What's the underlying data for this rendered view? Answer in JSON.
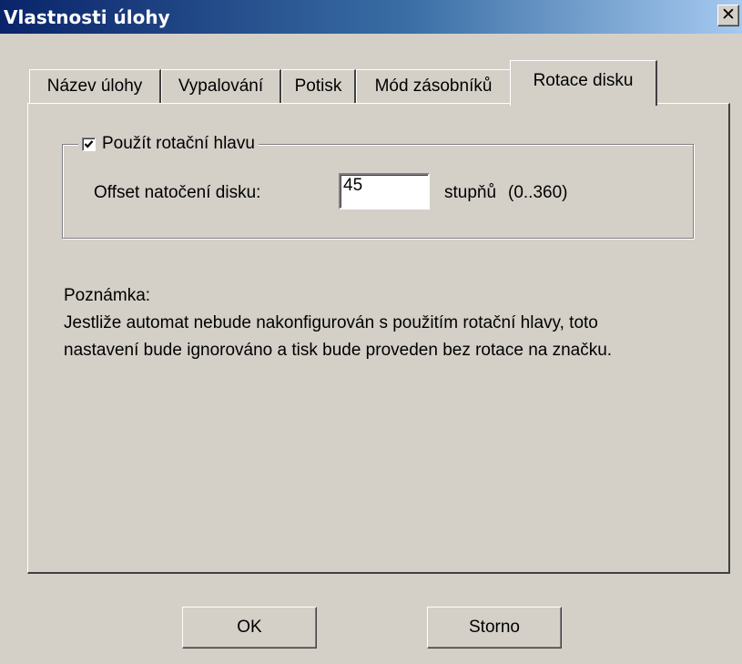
{
  "window": {
    "title": "Vlastnosti úlohy",
    "close_glyph": "✕"
  },
  "tabs": [
    {
      "label": "Název úlohy",
      "selected": false
    },
    {
      "label": "Vypalování",
      "selected": false
    },
    {
      "label": "Potisk",
      "selected": false
    },
    {
      "label": "Mód zásobníků",
      "selected": false
    },
    {
      "label": "Rotace disku",
      "selected": true
    }
  ],
  "rotation_group": {
    "checkbox_label": "Použít rotační hlavu",
    "checked": true,
    "offset_label": "Offset natočení disku:",
    "offset_value": "45",
    "unit": "stupňů",
    "range": "(0..360)"
  },
  "note": {
    "heading": "Poznámka:",
    "line1": "Jestliže automat nebude nakonfigurován s použitím rotační hlavy, toto",
    "line2": "nastavení bude ignorováno a tisk bude proveden bez rotace na značku."
  },
  "buttons": {
    "ok": "OK",
    "cancel": "Storno"
  }
}
